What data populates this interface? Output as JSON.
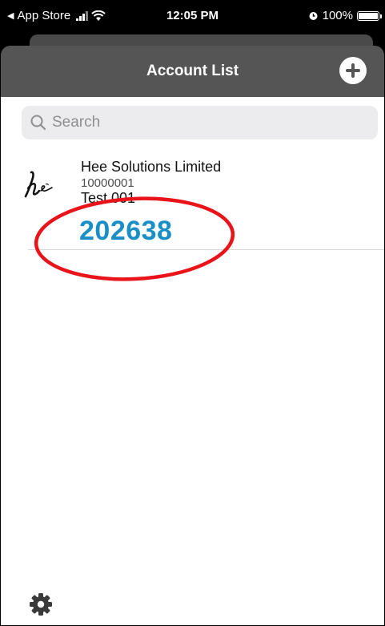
{
  "status_bar": {
    "back_app": "App Store",
    "time": "12:05 PM",
    "battery": "100%",
    "battery_level": 1.0
  },
  "nav": {
    "title": "Account List",
    "add_icon": "plus-circle-icon"
  },
  "search": {
    "placeholder": "Search",
    "value": ""
  },
  "accounts": [
    {
      "company": "Hee Solutions Limited",
      "number": "10000001",
      "label": "Test 001",
      "code": "202638",
      "logo_icon": "hee-logo"
    }
  ],
  "footer": {
    "settings_icon": "gear-icon"
  },
  "colors": {
    "nav_background": "#555555",
    "code_color": "#1a8fc7",
    "annotation_color": "#e8141a"
  }
}
